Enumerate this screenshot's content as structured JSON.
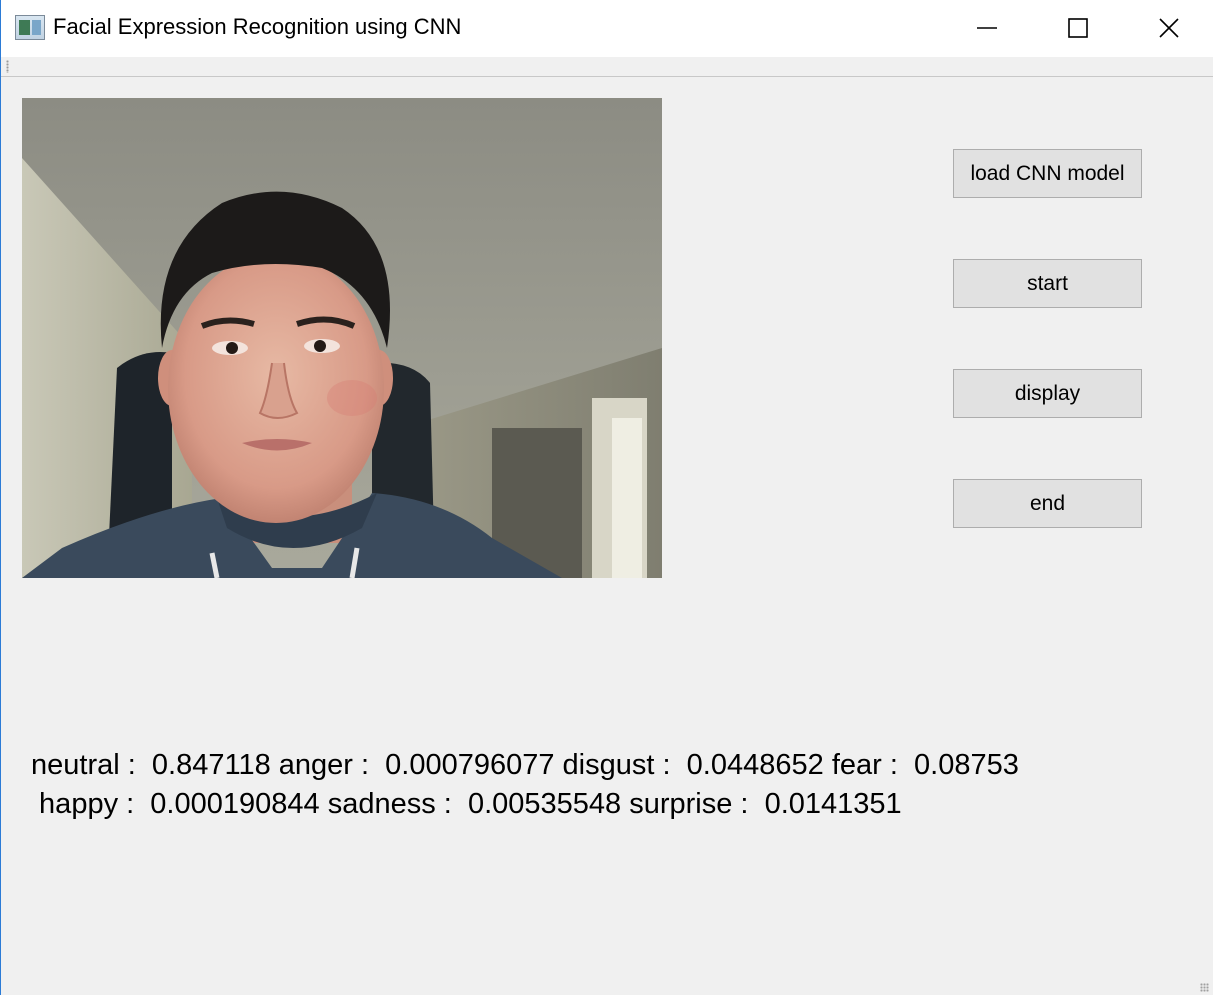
{
  "window": {
    "title": "Facial Expression Recognition using CNN"
  },
  "icons": {
    "app": "app-window-icon",
    "minimize": "minimize-icon",
    "maximize": "maximize-icon",
    "close": "close-icon"
  },
  "buttons": {
    "load_model": "load CNN model",
    "start": "start",
    "display": "display",
    "end": "end"
  },
  "results": {
    "line1": "neutral :  0.847118 anger :  0.000796077 disgust :  0.0448652 fear :  0.08753",
    "line2": " happy :  0.000190844 sadness :  0.00535548 surprise :  0.0141351"
  },
  "colors": {
    "window_bg": "#f0f0f0",
    "titlebar_bg": "#ffffff",
    "button_bg": "#e1e1e1",
    "button_border": "#adadad",
    "window_border": "#2b7bd6"
  }
}
